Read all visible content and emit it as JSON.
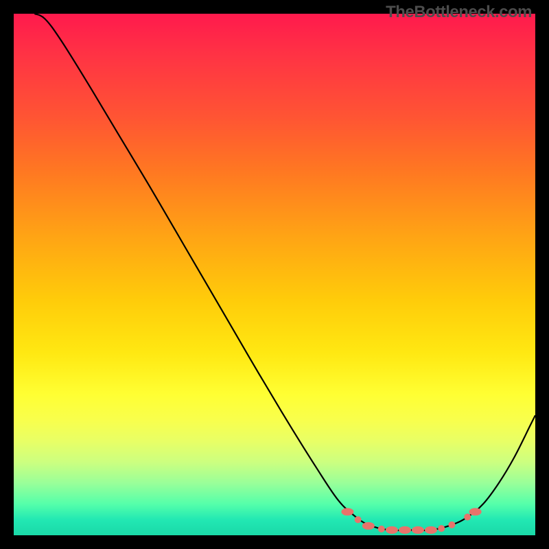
{
  "watermark": "TheBottleneck.com",
  "chart_data": {
    "type": "line",
    "title": "",
    "xlabel": "",
    "ylabel": "",
    "xlim": [
      0,
      100
    ],
    "ylim": [
      0,
      100
    ],
    "curve": [
      {
        "x": 4,
        "y": 100
      },
      {
        "x": 6,
        "y": 99
      },
      {
        "x": 9,
        "y": 95
      },
      {
        "x": 14,
        "y": 87
      },
      {
        "x": 20,
        "y": 77
      },
      {
        "x": 26,
        "y": 67
      },
      {
        "x": 33,
        "y": 55
      },
      {
        "x": 40,
        "y": 43
      },
      {
        "x": 47,
        "y": 31
      },
      {
        "x": 53,
        "y": 21
      },
      {
        "x": 58,
        "y": 13
      },
      {
        "x": 62,
        "y": 7
      },
      {
        "x": 65,
        "y": 4
      },
      {
        "x": 68,
        "y": 2
      },
      {
        "x": 72,
        "y": 1
      },
      {
        "x": 76,
        "y": 1
      },
      {
        "x": 80,
        "y": 1
      },
      {
        "x": 84,
        "y": 2
      },
      {
        "x": 87,
        "y": 3.5
      },
      {
        "x": 90,
        "y": 6
      },
      {
        "x": 93,
        "y": 10
      },
      {
        "x": 96,
        "y": 15
      },
      {
        "x": 99,
        "y": 21
      },
      {
        "x": 100,
        "y": 23
      }
    ],
    "markers": [
      {
        "x": 64,
        "y": 4.5,
        "shape": "oval"
      },
      {
        "x": 66,
        "y": 3,
        "shape": "dot"
      },
      {
        "x": 68,
        "y": 1.8,
        "shape": "oval"
      },
      {
        "x": 70.5,
        "y": 1.2,
        "shape": "dot"
      },
      {
        "x": 72.5,
        "y": 1,
        "shape": "oval"
      },
      {
        "x": 75,
        "y": 1,
        "shape": "oval"
      },
      {
        "x": 77.5,
        "y": 1,
        "shape": "oval"
      },
      {
        "x": 80,
        "y": 1,
        "shape": "oval"
      },
      {
        "x": 82,
        "y": 1.3,
        "shape": "dot"
      },
      {
        "x": 84,
        "y": 2,
        "shape": "dot"
      },
      {
        "x": 87,
        "y": 3.5,
        "shape": "dot"
      },
      {
        "x": 88.5,
        "y": 4.5,
        "shape": "oval"
      }
    ],
    "colors": {
      "curve": "#000000",
      "markers": "#e8736b"
    }
  }
}
